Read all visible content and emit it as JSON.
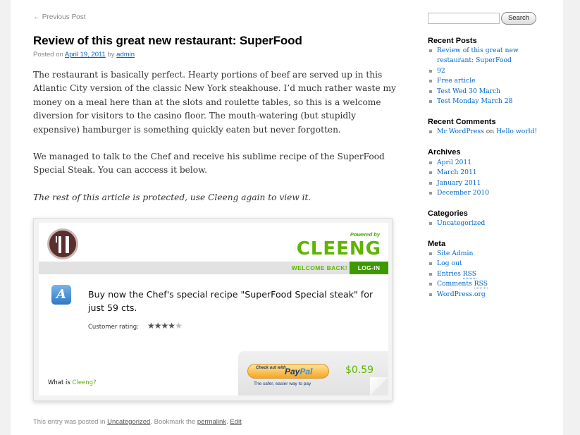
{
  "post": {
    "prev_link": "← Previous Post",
    "title": "Review of this great new restaurant: SuperFood",
    "meta_posted": "Posted on",
    "meta_date": "April 19, 2011",
    "meta_by": "by",
    "meta_author": "admin",
    "paragraphs": [
      "The restaurant is basically perfect. Hearty portions of beef are served up in this Atlantic City version of the classic New York steakhouse. I’d much rather waste my money on a meal here than at the slots and roulette tables, so this is a welcome diversion for visitors to the casino floor. The mouth-watering (but stupidly expensive) hamburger is something quickly eaten but never forgotten.",
      "We managed to talk to the Chef and receive his sublime recipe of the SuperFood Special Steak. You can acccess it below."
    ],
    "protected_note": "The rest of this article is protected, use Cleeng again to view it."
  },
  "cleeng": {
    "powered_by": "Powered by",
    "brand": "CLEENG",
    "welcome": "WELCOME BACK!",
    "login": "LOG-IN",
    "product_letter": "A",
    "offer_text": "Buy now the Chef's special recipe \"SuperFood Special steak\" for just 59 cts.",
    "rating_label": "Customer rating:",
    "rating": 4,
    "rating_max": 5,
    "what_is_prefix": "What is",
    "what_is_link": "Cleeng?",
    "paypal_small": "Check out with",
    "paypal_brand_a": "Pay",
    "paypal_brand_b": "Pal",
    "paypal_tagline": "The safer, easier way to pay",
    "price": "$0.59",
    "accent": "#5fb400"
  },
  "footer": {
    "text1": "This entry was posted in",
    "category": "Uncategorized",
    "text2": ". Bookmark the",
    "permalink": "permalink",
    "sep": ".",
    "edit": "Edit"
  },
  "sidebar": {
    "search_placeholder": "",
    "search_button": "Search",
    "recent_posts_title": "Recent Posts",
    "recent_posts": [
      "Review of this great new restaurant: SuperFood",
      "92",
      "Free article",
      "Test Wed 30 March",
      "Test Monday March 28"
    ],
    "recent_comments_title": "Recent Comments",
    "comment_author": "Mr WordPress",
    "comment_on": "on",
    "comment_post": "Hello world!",
    "archives_title": "Archives",
    "archives": [
      "April 2011",
      "March 2011",
      "January 2011",
      "December 2010"
    ],
    "categories_title": "Categories",
    "categories": [
      "Uncategorized"
    ],
    "meta_title": "Meta",
    "meta_site_admin": "Site Admin",
    "meta_logout": "Log out",
    "meta_entries": "Entries",
    "meta_comments": "Comments",
    "meta_rss": "RSS",
    "meta_wporg": "WordPress.org"
  }
}
